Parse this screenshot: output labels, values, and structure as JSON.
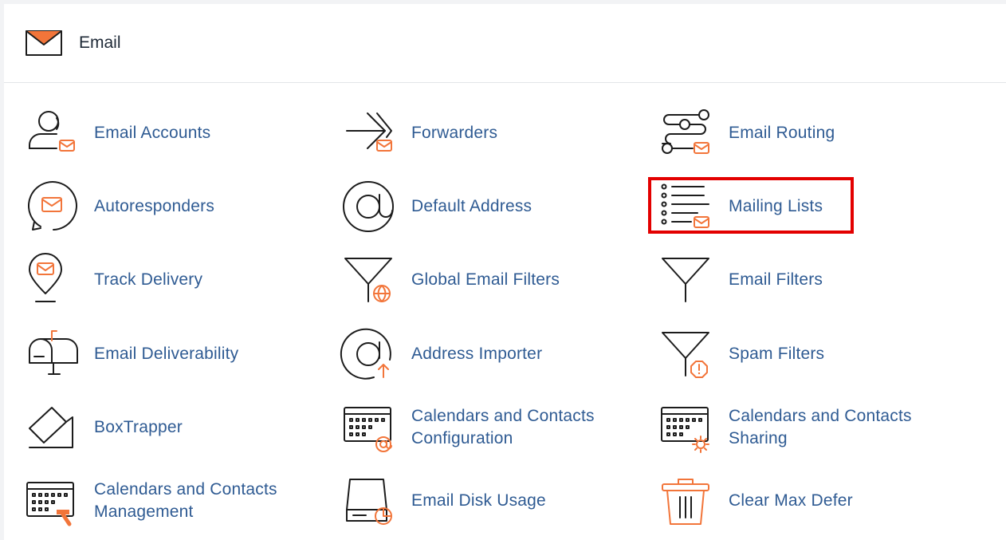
{
  "section": {
    "title": "Email",
    "icon": "envelope-icon"
  },
  "colors": {
    "accent": "#f2753a",
    "link": "#2f5b93",
    "highlight": "#e30000"
  },
  "items": [
    {
      "label": "Email Accounts",
      "icon": "email-accounts-icon"
    },
    {
      "label": "Forwarders",
      "icon": "forwarders-icon"
    },
    {
      "label": "Email Routing",
      "icon": "email-routing-icon"
    },
    {
      "label": "Autoresponders",
      "icon": "autoresponders-icon"
    },
    {
      "label": "Default Address",
      "icon": "default-address-icon"
    },
    {
      "label": "Mailing Lists",
      "icon": "mailing-lists-icon",
      "highlighted": true
    },
    {
      "label": "Track Delivery",
      "icon": "track-delivery-icon"
    },
    {
      "label": "Global Email Filters",
      "icon": "global-filter-icon"
    },
    {
      "label": "Email Filters",
      "icon": "filter-icon"
    },
    {
      "label": "Email Deliverability",
      "icon": "mailbox-icon"
    },
    {
      "label": "Address Importer",
      "icon": "address-importer-icon"
    },
    {
      "label": "Spam Filters",
      "icon": "spam-filter-icon"
    },
    {
      "label": "BoxTrapper",
      "icon": "boxtrapper-icon"
    },
    {
      "label": "Calendars and Contacts Configuration",
      "icon": "calendar-config-icon"
    },
    {
      "label": "Calendars and Contacts Sharing",
      "icon": "calendar-sharing-icon"
    },
    {
      "label": "Calendars and Contacts Management",
      "icon": "calendar-management-icon"
    },
    {
      "label": "Email Disk Usage",
      "icon": "disk-usage-icon"
    },
    {
      "label": "Clear Max Defer",
      "icon": "trash-icon"
    }
  ]
}
